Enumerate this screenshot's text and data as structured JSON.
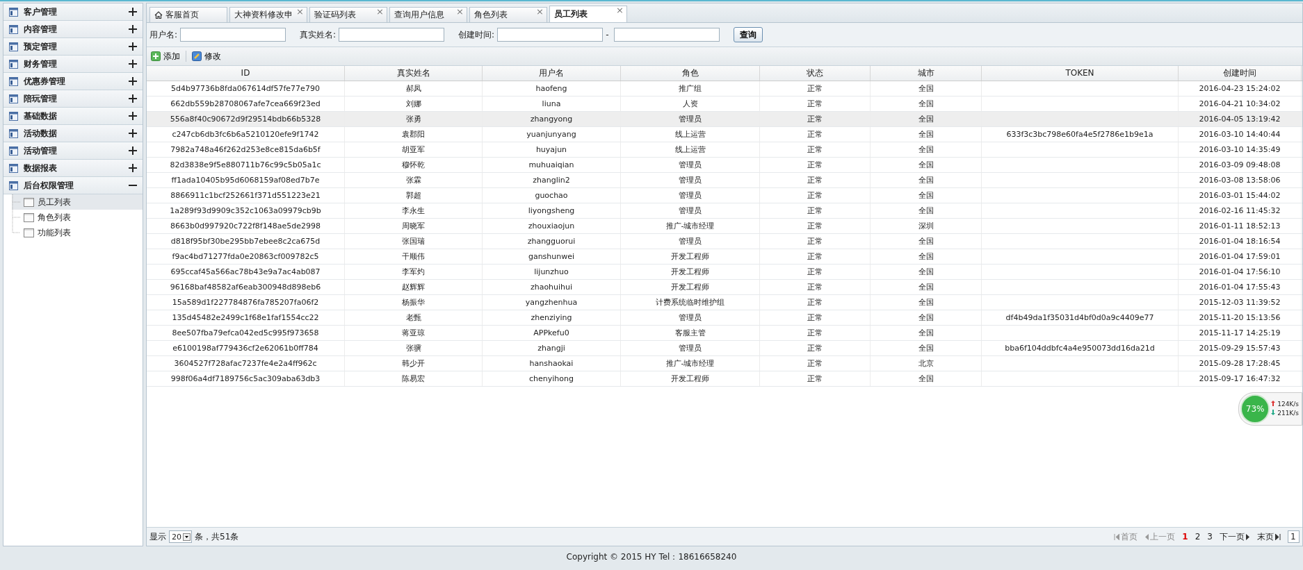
{
  "sidebar": {
    "groups": [
      {
        "label": "客户管理",
        "expanded": false
      },
      {
        "label": "内容管理",
        "expanded": false
      },
      {
        "label": "预定管理",
        "expanded": false
      },
      {
        "label": "财务管理",
        "expanded": false
      },
      {
        "label": "优惠券管理",
        "expanded": false
      },
      {
        "label": "陪玩管理",
        "expanded": false
      },
      {
        "label": "基础数据",
        "expanded": false
      },
      {
        "label": "活动数据",
        "expanded": false
      },
      {
        "label": "活动管理",
        "expanded": false
      },
      {
        "label": "数据报表",
        "expanded": false
      },
      {
        "label": "后台权限管理",
        "expanded": true,
        "children": [
          {
            "label": "员工列表",
            "selected": true
          },
          {
            "label": "角色列表",
            "selected": false
          },
          {
            "label": "功能列表",
            "selected": false
          }
        ]
      }
    ]
  },
  "tabs": [
    {
      "label": "客服首页",
      "selected": false,
      "kind": "home"
    },
    {
      "label": "大神资料修改申",
      "selected": false,
      "kind": "closable"
    },
    {
      "label": "验证码列表",
      "selected": false,
      "kind": "closable"
    },
    {
      "label": "查询用户信息",
      "selected": false,
      "kind": "closable"
    },
    {
      "label": "角色列表",
      "selected": false,
      "kind": "closable"
    },
    {
      "label": "员工列表",
      "selected": true,
      "kind": "closable"
    }
  ],
  "close_symbol": "×",
  "search": {
    "username_label": "用户名:",
    "realname_label": "真实姓名:",
    "created_label": "创建时间:",
    "range_separator": "-",
    "button": "查询"
  },
  "toolbar": [
    {
      "label": "添加",
      "kind": "add"
    },
    {
      "label": "修改",
      "kind": "edit"
    }
  ],
  "table": {
    "columns": [
      "ID",
      "真实姓名",
      "用户名",
      "角色",
      "状态",
      "城市",
      "TOKEN",
      "创建时间"
    ],
    "rows": [
      {
        "selected": false,
        "cells": [
          "5d4b97736b8fda067614df57fe77e790",
          "郝凤",
          "haofeng",
          "推广组",
          "正常",
          "全国",
          "",
          "2016-04-23 15:24:02"
        ]
      },
      {
        "selected": false,
        "cells": [
          "662db559b28708067afe7cea669f23ed",
          "刘娜",
          "liuna",
          "人资",
          "正常",
          "全国",
          "",
          "2016-04-21 10:34:02"
        ]
      },
      {
        "selected": true,
        "cells": [
          "556a8f40c90672d9f29514bdb66b5328",
          "张勇",
          "zhangyong",
          "管理员",
          "正常",
          "全国",
          "",
          "2016-04-05 13:19:42"
        ]
      },
      {
        "selected": false,
        "cells": [
          "c247cb6db3fc6b6a5210120efe9f1742",
          "袁郡阳",
          "yuanjunyang",
          "线上运营",
          "正常",
          "全国",
          "633f3c3bc798e60fa4e5f2786e1b9e1a",
          "2016-03-10 14:40:44"
        ]
      },
      {
        "selected": false,
        "cells": [
          "7982a748a46f262d253e8ce815da6b5f",
          "胡亚军",
          "huyajun",
          "线上运营",
          "正常",
          "全国",
          "",
          "2016-03-10 14:35:49"
        ]
      },
      {
        "selected": false,
        "cells": [
          "82d3838e9f5e880711b76c99c5b05a1c",
          "穆怀乾",
          "muhuaiqian",
          "管理员",
          "正常",
          "全国",
          "",
          "2016-03-09 09:48:08"
        ]
      },
      {
        "selected": false,
        "cells": [
          "ff1ada10405b95d6068159af08ed7b7e",
          "张霖",
          "zhanglin2",
          "管理员",
          "正常",
          "全国",
          "",
          "2016-03-08 13:58:06"
        ]
      },
      {
        "selected": false,
        "cells": [
          "8866911c1bcf252661f371d551223e21",
          "郭超",
          "guochao",
          "管理员",
          "正常",
          "全国",
          "",
          "2016-03-01 15:44:02"
        ]
      },
      {
        "selected": false,
        "cells": [
          "1a289f93d9909c352c1063a09979cb9b",
          "李永生",
          "liyongsheng",
          "管理员",
          "正常",
          "全国",
          "",
          "2016-02-16 11:45:32"
        ]
      },
      {
        "selected": false,
        "cells": [
          "8663b0d997920c722f8f148ae5de2998",
          "周晓军",
          "zhouxiaojun",
          "推广-城市经理",
          "正常",
          "深圳",
          "",
          "2016-01-11 18:52:13"
        ]
      },
      {
        "selected": false,
        "cells": [
          "d818f95bf30be295bb7ebee8c2ca675d",
          "张国瑞",
          "zhangguorui",
          "管理员",
          "正常",
          "全国",
          "",
          "2016-01-04 18:16:54"
        ]
      },
      {
        "selected": false,
        "cells": [
          "f9ac4bd71277fda0e20863cf009782c5",
          "干顺伟",
          "ganshunwei",
          "开发工程师",
          "正常",
          "全国",
          "",
          "2016-01-04 17:59:01"
        ]
      },
      {
        "selected": false,
        "cells": [
          "695ccaf45a566ac78b43e9a7ac4ab087",
          "李军灼",
          "lijunzhuo",
          "开发工程师",
          "正常",
          "全国",
          "",
          "2016-01-04 17:56:10"
        ]
      },
      {
        "selected": false,
        "cells": [
          "96168baf48582af6eab300948d898eb6",
          "赵辉辉",
          "zhaohuihui",
          "开发工程师",
          "正常",
          "全国",
          "",
          "2016-01-04 17:55:43"
        ]
      },
      {
        "selected": false,
        "cells": [
          "15a589d1f227784876fa785207fa06f2",
          "杨振华",
          "yangzhenhua",
          "计费系统临时维护组",
          "正常",
          "全国",
          "",
          "2015-12-03 11:39:52"
        ]
      },
      {
        "selected": false,
        "cells": [
          "135d45482e2499c1f68e1faf1554cc22",
          "老甄",
          "zhenziying",
          "管理员",
          "正常",
          "全国",
          "df4b49da1f35031d4bf0d0a9c4409e77",
          "2015-11-20 15:13:56"
        ]
      },
      {
        "selected": false,
        "cells": [
          "8ee507fba79efca042ed5c995f973658",
          "蒋亚琼",
          "APPkefu0",
          "客服主管",
          "正常",
          "全国",
          "",
          "2015-11-17 14:25:19"
        ]
      },
      {
        "selected": false,
        "cells": [
          "e6100198af779436cf2e62061b0ff784",
          "张骥",
          "zhangji",
          "管理员",
          "正常",
          "全国",
          "bba6f104ddbfc4a4e950073dd16da21d",
          "2015-09-29 15:57:43"
        ]
      },
      {
        "selected": false,
        "cells": [
          "3604527f728afac7237fe4e2a4ff962c",
          "韩少开",
          "hanshaokai",
          "推广-城市经理",
          "正常",
          "北京",
          "",
          "2015-09-28 17:28:45"
        ]
      },
      {
        "selected": false,
        "cells": [
          "998f06a4df7189756c5ac309aba63db3",
          "陈易宏",
          "chenyihong",
          "开发工程师",
          "正常",
          "全国",
          "",
          "2015-09-17 16:47:32"
        ]
      }
    ]
  },
  "pager": {
    "show_label": "显示",
    "page_size": "20",
    "total": "条，共51条",
    "first": "首页",
    "prev": "上一页",
    "pages": [
      {
        "label": "1",
        "selected": true
      },
      {
        "label": "2",
        "selected": false
      },
      {
        "label": "3",
        "selected": false
      }
    ],
    "next": "下一页",
    "last": "末页",
    "page_input": "1"
  },
  "speed_widget": {
    "percent": "73%",
    "upload": "124K/s",
    "download": "211K/s"
  },
  "footer": "Copyright © 2015 HY Tel：18616658240"
}
